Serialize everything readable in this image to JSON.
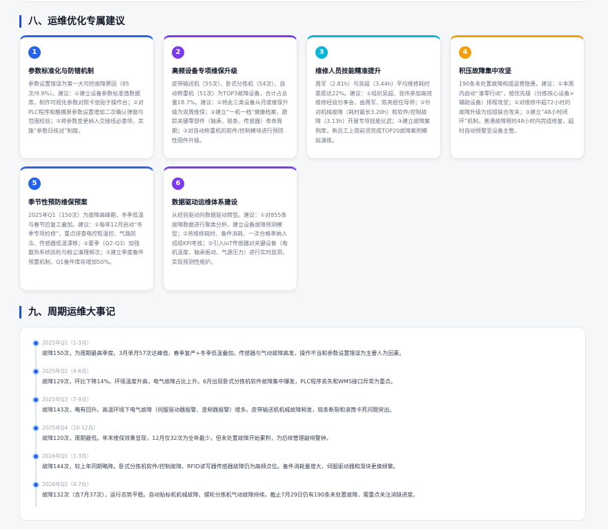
{
  "section8": {
    "title": "八、运维优化专属建议",
    "cards": [
      {
        "num": "1",
        "color": "#2563eb",
        "title": "参数标准化与防错机制",
        "text": "参数设置错误为第一大可控故障原因（85次/9.9%）。建议：①建立设备参数标准值数据库，制作可视化参数对照卡张贴于操作台；②对PLC程序和触摸屏参数设置增加二次确认弹窗与范围校验；③将参数变更纳入交接班必查项，实施“参数日核对”制度。"
      },
      {
        "num": "2",
        "color": "#7c3aed",
        "title": "高频设备专项维保升级",
        "text": "皮带输送机（55次）、卧式分拣机（54次）、自动称重机（51次）为TOP3故障设备，合计占总量18.7%。建议：①将此三类设备从月度维保升级为双周维保；②建立“一机一档”健康档案，跟踪关键零部件（轴承、链条、传感器）寿命周期；③对自动称重机的软件/控制模块进行预防性固件升级。"
      },
      {
        "num": "3",
        "color": "#06b6d4",
        "title": "维修人员技能精准提升",
        "text": "周军（2.81h）与吴超（3.44h）平均维修耗时差距达22%。建议：①组织吴超、张伟参加高效维修经验分享会，由周军、陈亮担任导师；②针对机械故障（耗时最长3.20h）和软件/控制故障（3.13h）开展专项技能比武；③建立故障案例库，新员工上岗前须完成TOP20故障案例模拟演练。"
      },
      {
        "num": "4",
        "color": "#f59e0b",
        "title": "积压故障集中攻坚",
        "text": "190条未处置故障构成运营隐患。建议：①本周内启动“清零行动”，按优先级（分拣核心设备>辅助设备）排程攻坚；②对维修中超72小时的故障升级为班组联合攻关；③建立“48小时闭环”机制，普通故障限时48小时内完成修复，超时自动预警至设备主管。"
      },
      {
        "num": "5",
        "color": "#2563eb",
        "title": "季节性预防维保预案",
        "text": "2025年Q1（150次）为故障高峰期，冬季低温与春节后复工叠加。建议：①每年12月启动“冬季专项检修”，重点排查电控柜温控、气路防冻、传感器低温漂移；②夏季（Q2-Q3）加强散热系统巡检与粉尘清理频次；③建立季度备件预置机制，Q1备件库存增加50%。"
      },
      {
        "num": "6",
        "color": "#7c3aed",
        "title": "数据驱动运维体系建设",
        "text": "从经验驱动向数据驱动转型。建议：①对855条故障数据进行聚类分析，建立设备故障预测模型；②将维修耗时、备件消耗、一次合格率纳入班组KPI考核；③引入IoT传感器对关键设备（电机温度、轴承振动、气源压力）进行实时监测，实现预测性维护。"
      }
    ]
  },
  "section9": {
    "title": "九、周期运维大事记",
    "items": [
      {
        "period": "2025年Q1（1-3月）",
        "text": "故障150次，为周期最高季度。3月单月57次达峰值，春季复产+冬季低温叠加。传感器与气动故障高发，操作不当和参数设置错误为主要人为因素。"
      },
      {
        "period": "2025年Q2（4-6月）",
        "text": "故障129次，环比下降14%。环境温度升高，电气故障占比上升。6月出现卧式分拣机软件故障集中爆发，PLC程序丢失和WMS接口异常为重点。"
      },
      {
        "period": "2025年Q3（7-9月）",
        "text": "故障143次，略有回升。高温环境下电气故障（伺服驱动器报警、变频器报警）增多。皮带输送机机械故障频发，链条断裂和滚筒卡死问题突出。"
      },
      {
        "period": "2025年Q4（10-12月）",
        "text": "故障120次，周期最低。年末维保效果显现，12月仅32次为全年最少。但未处置故障开始累积，为后续管理敲响警钟。"
      },
      {
        "period": "2026年Q1（1-3月）",
        "text": "故障144次，较上年同期略降。卧式分拣机软件/控制故障、RFID读写器传感器故障仍为高频点位。备件消耗量增大，伺服驱动器和滑块更换频繁。"
      },
      {
        "period": "2026年Q2（4-7月）",
        "text": "故障132次（含7月37次），运行态势平稳。自动贴标机机械故障、摆轮分拣机气动故障持续。截止7月29日仍有190条未处置故障，需重点关注消缺进度。"
      }
    ]
  }
}
